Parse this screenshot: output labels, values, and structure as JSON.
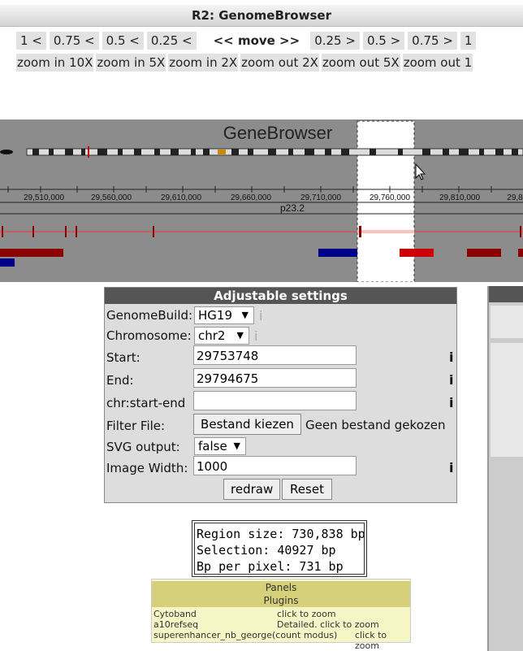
{
  "window": {
    "title": "R2: GenomeBrowser"
  },
  "move_row": [
    "1 <",
    "0.75 <",
    "0.5 <",
    "0.25 <",
    "<< move >>",
    "0.25 >",
    "0.5 >",
    "0.75 >",
    "1"
  ],
  "zoom_row": [
    "zoom in 10X",
    "zoom in 5X",
    "zoom in 2X",
    "zoom out 2X",
    "zoom out 5X",
    "zoom out 1"
  ],
  "browser": {
    "title": "GeneBrowser",
    "ticks": [
      "29,510,000",
      "29,560,000",
      "29,610,000",
      "29,660,000",
      "29,710,000",
      "29,760,000",
      "29,810,000",
      "29,8"
    ],
    "band": "p23.2"
  },
  "settings": {
    "title": "Adjustable settings",
    "genome_label": "GenomeBuild:",
    "genome_value": "HG19",
    "chromosome_label": "Chromosome:",
    "chromosome_value": "chr2",
    "start_label": "Start:",
    "start_value": "29753748",
    "end_label": "End:",
    "end_value": "29794675",
    "range_label": "chr:start-end",
    "range_value": "",
    "filter_label": "Filter File:",
    "filter_button": "Bestand kiezen",
    "filter_status": "Geen bestand gekozen",
    "svg_label": "SVG output:",
    "svg_value": "false",
    "width_label": "Image Width:",
    "width_value": "1000",
    "info_glyph": "i",
    "redraw_button": "redraw",
    "reset_button": "Reset"
  },
  "region": {
    "size": "Region size: 730,838 bp",
    "selection": "Selection: 40927 bp",
    "bp_per_pixel": "Bp per pixel: 731 bp"
  },
  "panels": {
    "header": "Panels",
    "subheader": "Plugins",
    "plugins": [
      {
        "name": "Cytoband",
        "desc": "click to zoom"
      },
      {
        "name": "a10refseq",
        "desc": "Detailed. click to zoom"
      },
      {
        "name": "superenhancer_nb_george(count modus)",
        "desc": "click to zoom"
      }
    ]
  },
  "colors": {
    "track_red": "#8b0000",
    "track_blue": "#00008b",
    "browser_bg": "#8c8c8c"
  }
}
